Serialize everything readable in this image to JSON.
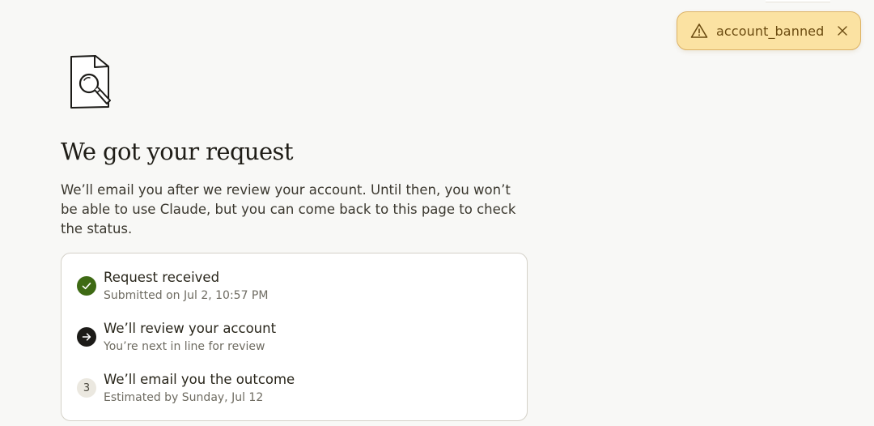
{
  "toast": {
    "message": "account_banned",
    "icon": "warning-icon",
    "close_icon": "close-icon"
  },
  "page": {
    "title": "We got your request",
    "description": "We’ll email you after we review your account. Until then, you won’t be able to use Claude, but you can come back to this page to check the status."
  },
  "steps": [
    {
      "title": "Request received",
      "subtitle": "Submitted on Jul 2, 10:57 PM",
      "status": "done",
      "icon": "check-icon"
    },
    {
      "title": "We’ll review your account",
      "subtitle": "You’re next in line for review",
      "status": "current",
      "icon": "arrow-right-icon"
    },
    {
      "title": "We’ll email you the outcome",
      "subtitle": "Estimated by Sunday, Jul 12",
      "status": "pending",
      "number": "3"
    }
  ],
  "colors": {
    "background": "#f8f8f6",
    "toast_bg": "#fbe2a2",
    "toast_text": "#6b4b10",
    "done": "#3e6a14",
    "current": "#1c1b18"
  }
}
